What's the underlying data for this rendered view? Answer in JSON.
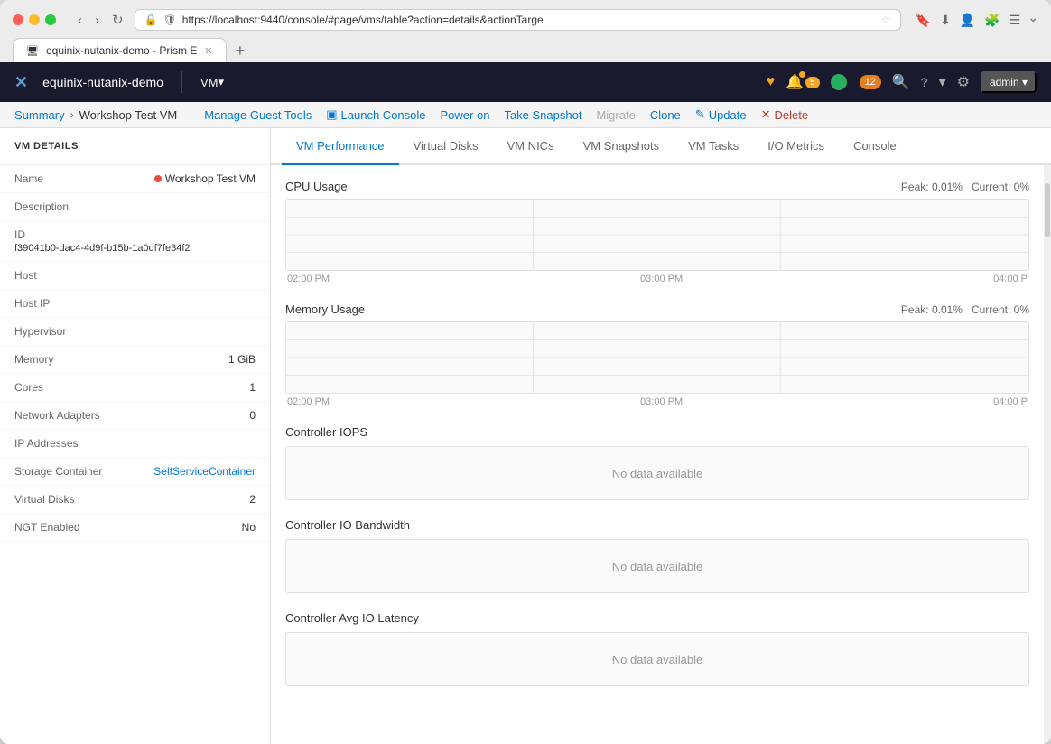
{
  "browser": {
    "tab_title": "equinix-nutanix-demo - Prism E",
    "url": "https://localhost:9440/console/#page/vms/table?action=details&actionTarge",
    "tab_icon": "🖥",
    "new_tab_label": "+",
    "nav_back": "‹",
    "nav_forward": "›",
    "nav_refresh": "↻"
  },
  "topnav": {
    "logo": "✕",
    "title": "equinix-nutanix-demo",
    "vm_label": "VM",
    "vm_dropdown": "▾",
    "search_icon": "🔍",
    "help_icon": "?",
    "settings_icon": "⚙",
    "user": "admin",
    "user_dropdown": "▾",
    "alert_count": "5",
    "vm_count": "12",
    "nutanix_icon": "♥"
  },
  "breadcrumb": {
    "summary_link": "Summary",
    "separator": "›",
    "current_page": "Workshop Test VM"
  },
  "actions": [
    {
      "id": "manage-guest-tools",
      "label": "Manage Guest Tools",
      "icon": "",
      "disabled": false,
      "danger": false
    },
    {
      "id": "launch-console",
      "label": "Launch Console",
      "icon": "▣",
      "disabled": false,
      "danger": false
    },
    {
      "id": "power-on",
      "label": "Power on",
      "icon": "",
      "disabled": false,
      "danger": false
    },
    {
      "id": "take-snapshot",
      "label": "Take Snapshot",
      "icon": "",
      "disabled": false,
      "danger": false
    },
    {
      "id": "migrate",
      "label": "Migrate",
      "icon": "",
      "disabled": true,
      "danger": false
    },
    {
      "id": "clone",
      "label": "Clone",
      "icon": "",
      "disabled": false,
      "danger": false
    },
    {
      "id": "update",
      "label": "Update",
      "icon": "✎",
      "disabled": false,
      "danger": false
    },
    {
      "id": "delete",
      "label": "Delete",
      "icon": "✕",
      "disabled": false,
      "danger": true
    }
  ],
  "vm_details": {
    "panel_header": "VM DETAILS",
    "fields": [
      {
        "label": "Name",
        "value": "Workshop Test VM",
        "type": "status"
      },
      {
        "label": "Description",
        "value": "",
        "type": "text"
      },
      {
        "label": "ID",
        "value": "f39041b0-dac4-4d9f-b15b-1a0df7fe34f2",
        "type": "id"
      },
      {
        "label": "Host",
        "value": "",
        "type": "text"
      },
      {
        "label": "Host IP",
        "value": "",
        "type": "text"
      },
      {
        "label": "Hypervisor",
        "value": "",
        "type": "text"
      },
      {
        "label": "Memory",
        "value": "1 GiB",
        "type": "text"
      },
      {
        "label": "Cores",
        "value": "1",
        "type": "text"
      },
      {
        "label": "Network Adapters",
        "value": "0",
        "type": "text"
      },
      {
        "label": "IP Addresses",
        "value": "",
        "type": "text"
      },
      {
        "label": "Storage Container",
        "value": "SelfServiceContainer",
        "type": "link"
      },
      {
        "label": "Virtual Disks",
        "value": "2",
        "type": "text"
      },
      {
        "label": "NGT Enabled",
        "value": "No",
        "type": "text"
      }
    ]
  },
  "tabs": [
    {
      "id": "vm-performance",
      "label": "VM Performance",
      "active": true
    },
    {
      "id": "virtual-disks",
      "label": "Virtual Disks",
      "active": false
    },
    {
      "id": "vm-nics",
      "label": "VM NICs",
      "active": false
    },
    {
      "id": "vm-snapshots",
      "label": "VM Snapshots",
      "active": false
    },
    {
      "id": "vm-tasks",
      "label": "VM Tasks",
      "active": false
    },
    {
      "id": "io-metrics",
      "label": "I/O Metrics",
      "active": false
    },
    {
      "id": "console",
      "label": "Console",
      "active": false
    }
  ],
  "charts": [
    {
      "id": "cpu-usage",
      "title": "CPU Usage",
      "peak": "Peak: 0.01%",
      "current": "Current: 0%",
      "has_data": true,
      "time_labels": [
        "02:00 PM",
        "03:00 PM",
        "04:00 P"
      ]
    },
    {
      "id": "memory-usage",
      "title": "Memory Usage",
      "peak": "Peak: 0.01%",
      "current": "Current: 0%",
      "has_data": true,
      "time_labels": [
        "02:00 PM",
        "03:00 PM",
        "04:00 P"
      ]
    }
  ],
  "no_data_sections": [
    {
      "id": "controller-iops",
      "title": "Controller IOPS",
      "message": "No data available"
    },
    {
      "id": "controller-io-bandwidth",
      "title": "Controller IO Bandwidth",
      "message": "No data available"
    },
    {
      "id": "controller-avg-io-latency",
      "title": "Controller Avg IO Latency",
      "message": "No data available"
    }
  ]
}
